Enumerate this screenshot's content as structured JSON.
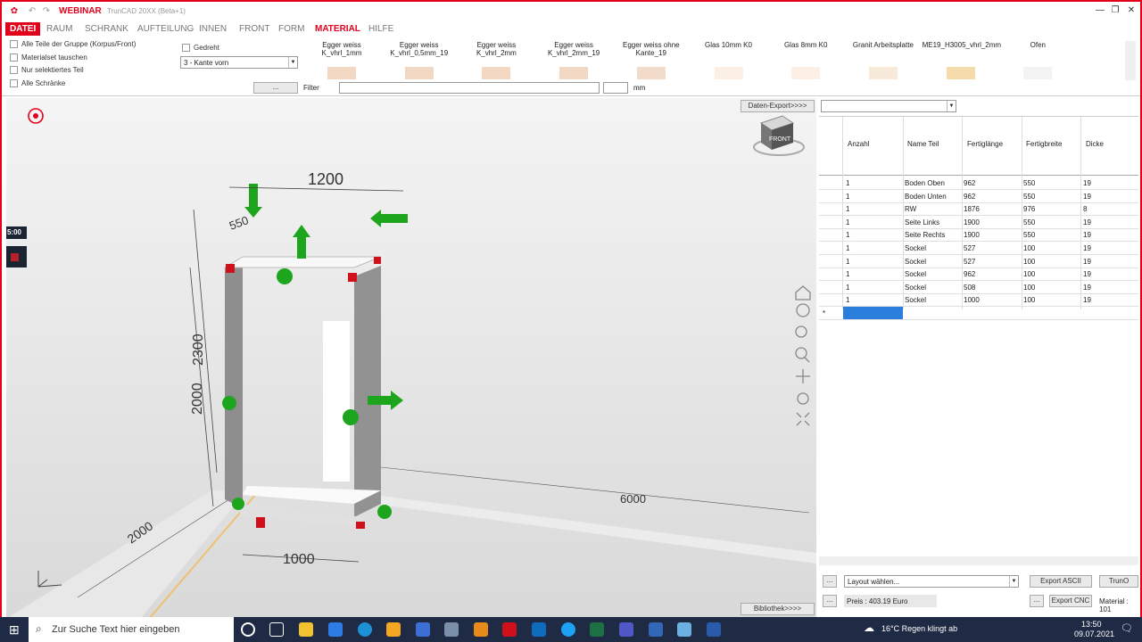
{
  "titlebar": {
    "brand": "WEBINAR",
    "title": "TrunCAD 20XX (Beta+1)"
  },
  "menu": [
    "DATEI",
    "RAUM",
    "SCHRANK",
    "AUFTEILUNG",
    "INNEN",
    "FRONT",
    "FORM",
    "MATERIAL",
    "HILFE"
  ],
  "options": {
    "alle_teile": "Alle Teile der Gruppe (Korpus/Front)",
    "materialset": "Materialset tauschen",
    "nur_selektiert": "Nur selektiertes Teil",
    "alle_schraenke": "Alle Schränke",
    "gedreht": "Gedreht",
    "kante": "3 - Kante vorn",
    "dots": "...",
    "filter": "Filter",
    "mm": "mm"
  },
  "materials": [
    {
      "name": "Egger weiss K_vhrl_1mm",
      "color": "#f2d7c2"
    },
    {
      "name": "Egger weiss K_vhrl_0,5mm_19",
      "color": "#f2d7c2"
    },
    {
      "name": "Egger weiss K_vhrl_2mm",
      "color": "#f2d7c2"
    },
    {
      "name": "Egger weiss K_vhrl_2mm_19",
      "color": "#f2d7c2"
    },
    {
      "name": "Egger weiss ohne Kante_19",
      "color": "#f3dbc9"
    },
    {
      "name": "Glas 10mm K0",
      "color": "#fbf0e3"
    },
    {
      "name": "Glas 8mm K0",
      "color": "#fbf0e3"
    },
    {
      "name": "Granit Arbeitsplatte",
      "color": "#f8ead8"
    },
    {
      "name": "ME19_H3005_vhrl_2mm",
      "color": "#f6dcab"
    },
    {
      "name": "Ofen",
      "color": "#f3f3f3"
    }
  ],
  "viewport": {
    "timer": "5:00",
    "dims": {
      "w1200": "1200",
      "d550": "550",
      "h2300": "2300",
      "h2000": "2000",
      "w1000": "1000",
      "d2000": "2000",
      "l6000": "6000"
    },
    "daten_export": "Daten-Export>>>>",
    "bibliothek": "Bibliothek>>>>",
    "cube": "FRONT"
  },
  "table": {
    "headers": [
      "Anzahl",
      "Name Teil",
      "Fertiglänge",
      "Fertigbreite",
      "Dicke"
    ],
    "rows": [
      [
        "1",
        "Boden Oben",
        "962",
        "550",
        "19"
      ],
      [
        "1",
        "Boden Unten",
        "962",
        "550",
        "19"
      ],
      [
        "1",
        "RW",
        "1876",
        "976",
        "8"
      ],
      [
        "1",
        "Seite Links",
        "1900",
        "550",
        "19"
      ],
      [
        "1",
        "Seite Rechts",
        "1900",
        "550",
        "19"
      ],
      [
        "1",
        "Sockel",
        "527",
        "100",
        "19"
      ],
      [
        "1",
        "Sockel",
        "527",
        "100",
        "19"
      ],
      [
        "1",
        "Sockel",
        "962",
        "100",
        "19"
      ],
      [
        "1",
        "Sockel",
        "508",
        "100",
        "19"
      ],
      [
        "1",
        "Sockel",
        "1000",
        "100",
        "19"
      ]
    ],
    "new_row": "*"
  },
  "bottom": {
    "layout": "Layout wählen...",
    "export_ascii": "Export ASCII",
    "trun": "TrunO",
    "preis": "Preis : 403.19 Euro",
    "export_cnc": "Export CNC",
    "material": "Material : 101",
    "dots": "..."
  },
  "taskbar": {
    "search": "Zur Suche Text hier eingeben",
    "weather": "16°C Regen klingt ab",
    "time": "13:50",
    "date": "09.07.2021"
  }
}
